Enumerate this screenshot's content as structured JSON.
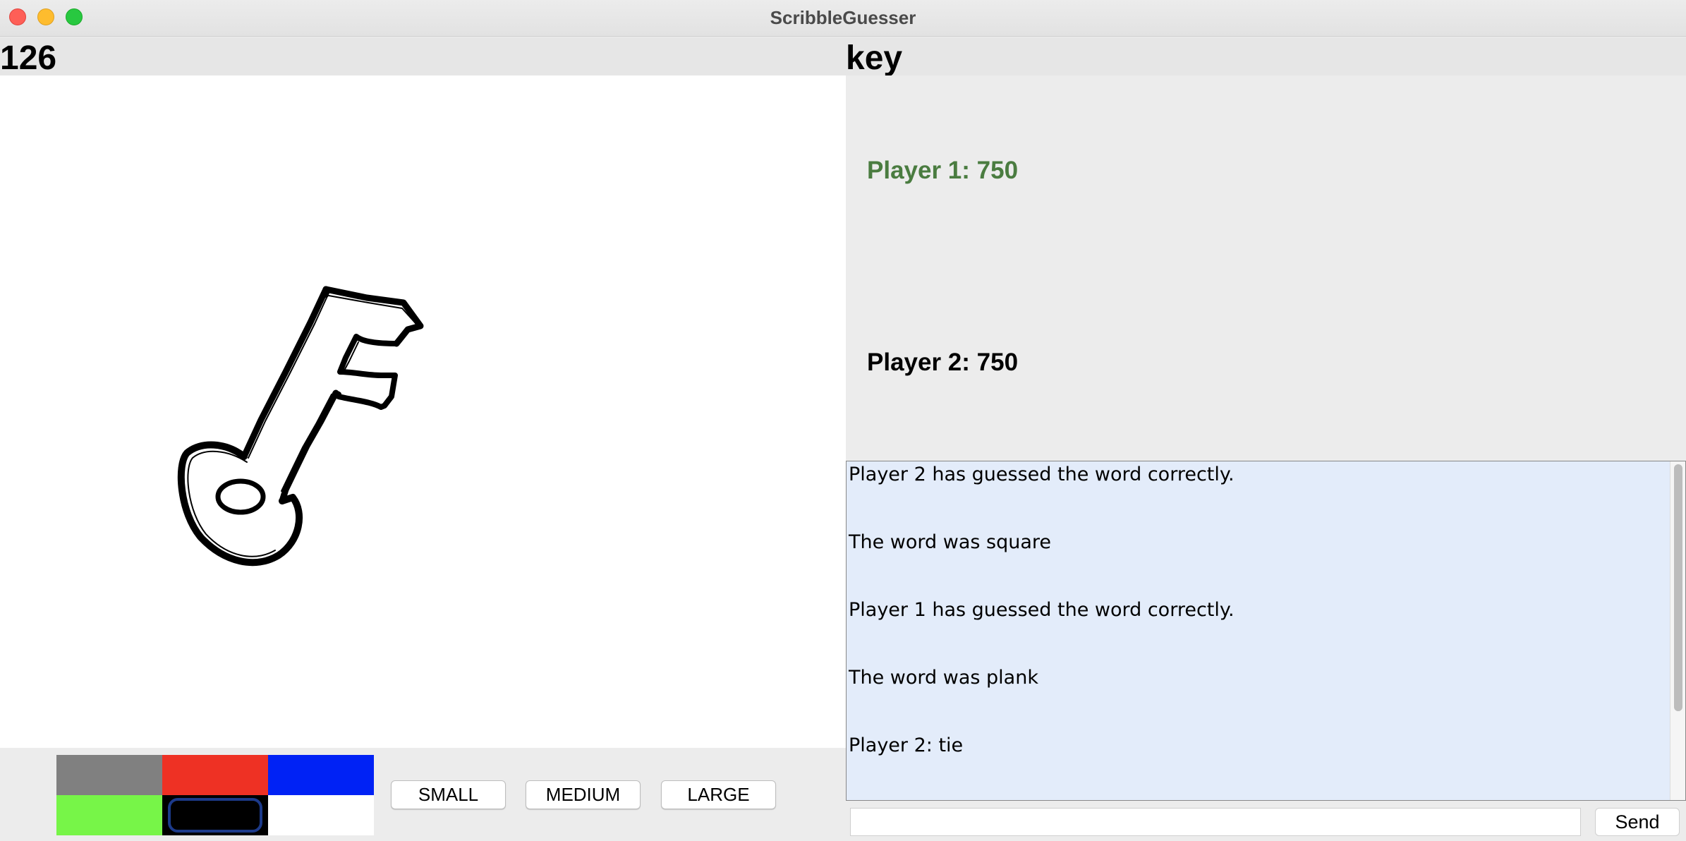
{
  "window": {
    "title": "ScribbleGuesser"
  },
  "timer": {
    "value": "126"
  },
  "word": {
    "value": "key"
  },
  "palette": {
    "colors": [
      "#808080",
      "#ee3124",
      "#0022f5",
      "#77f548",
      "#000000",
      "#ffffff"
    ],
    "selected_index": 4
  },
  "brush": {
    "small": "SMALL",
    "medium": "MEDIUM",
    "large": "LARGE"
  },
  "scores": {
    "player1": "Player 1: 750",
    "player1_color": "#4a7c40",
    "player2": "Player 2: 750",
    "player2_color": "#000000"
  },
  "chat": {
    "messages": [
      "Player 2 has guessed the word correctly.",
      "The word was square",
      "Player 1 has guessed the word correctly.",
      "The word was plank",
      "Player 2: tie"
    ],
    "input_value": "",
    "send_label": "Send"
  }
}
